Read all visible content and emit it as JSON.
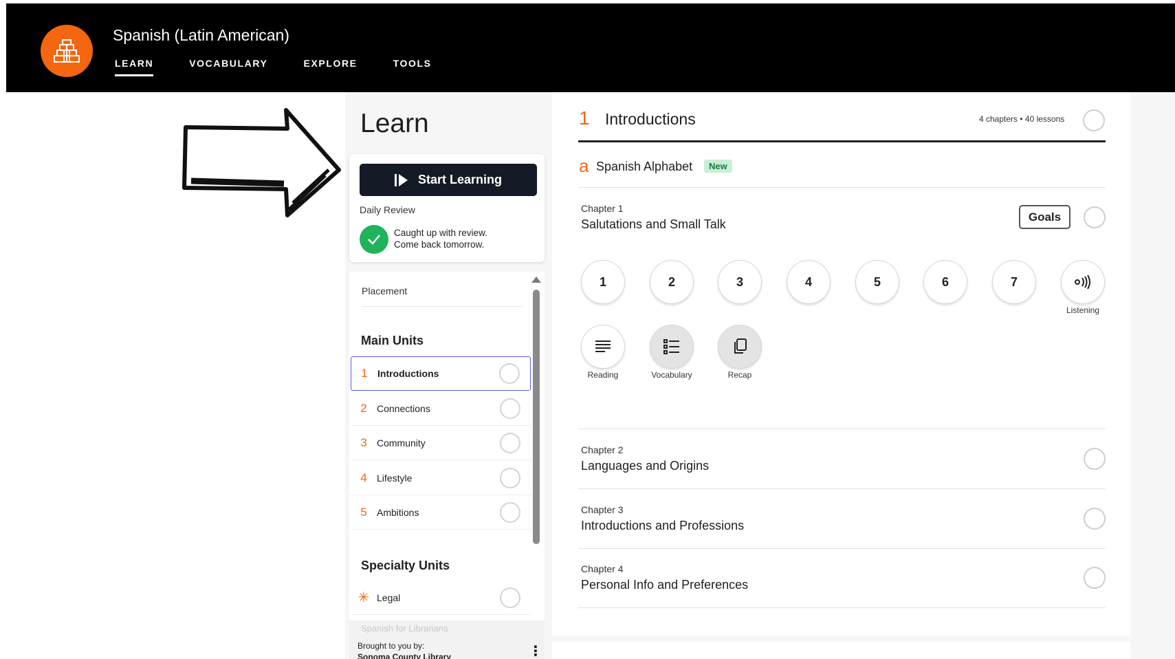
{
  "header": {
    "app_title": "Spanish (Latin American)",
    "nav": [
      "LEARN",
      "VOCABULARY",
      "EXPLORE",
      "TOOLS"
    ],
    "active_nav": "LEARN"
  },
  "sidebar": {
    "page_title": "Learn",
    "start_button": "Start Learning",
    "daily_review_label": "Daily Review",
    "review_status_line1": "Caught up with review.",
    "review_status_line2": "Come back tomorrow.",
    "placement": "Placement",
    "main_units_heading": "Main Units",
    "main_units": [
      {
        "num": "1",
        "label": "Introductions",
        "active": true
      },
      {
        "num": "2",
        "label": "Connections"
      },
      {
        "num": "3",
        "label": "Community"
      },
      {
        "num": "4",
        "label": "Lifestyle"
      },
      {
        "num": "5",
        "label": "Ambitions"
      }
    ],
    "specialty_heading": "Specialty Units",
    "specialty_units": [
      {
        "label": "Legal"
      },
      {
        "label": "Spanish for Librarians"
      }
    ],
    "footer_brought": "Brought to you by:",
    "footer_library": "Sonoma County Library"
  },
  "main": {
    "unit_num": "1",
    "unit_title": "Introductions",
    "unit_meta": "4 chapters • 40 lessons",
    "alphabet_letter": "a",
    "alphabet_title": "Spanish Alphabet",
    "alphabet_badge": "New",
    "chapter1": {
      "label": "Chapter 1",
      "title": "Salutations and Small Talk",
      "goals_button": "Goals",
      "lessons": [
        "1",
        "2",
        "3",
        "4",
        "5",
        "6",
        "7"
      ],
      "listening_label": "Listening",
      "extras": [
        "Reading",
        "Vocabulary",
        "Recap"
      ]
    },
    "chapters": [
      {
        "label": "Chapter 2",
        "title": "Languages and Origins"
      },
      {
        "label": "Chapter 3",
        "title": "Introductions and Professions"
      },
      {
        "label": "Chapter 4",
        "title": "Personal Info and Preferences"
      }
    ]
  },
  "colors": {
    "brand_orange": "#f4660f",
    "dark_button": "#141a26",
    "success_green": "#1fb35b",
    "active_border": "#5b5ccf",
    "new_badge_bg": "#c8efd7"
  },
  "icons": {
    "logo": "pyramid-icon",
    "start": "play-icon",
    "review": "check-icon",
    "listening": "sound-waves-icon",
    "reading": "text-lines-icon",
    "vocabulary": "list-icon",
    "recap": "copy-pages-icon",
    "specialty": "asterisk-icon",
    "annotation": "hand-drawn-arrow-icon"
  }
}
